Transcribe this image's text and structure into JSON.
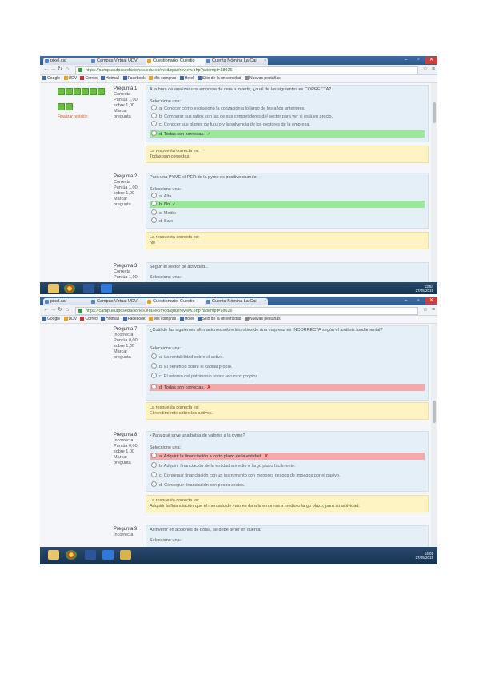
{
  "screens": [
    {
      "tabs": [
        "pixel.caf",
        "Campus Virtual UDV",
        "Cuestionario: Cuestio",
        "Cuenta Nómina La Cai"
      ],
      "url": "https://campusutpcsedaciones.edu.ec/mod/quiz/review.php?attempt=18026",
      "bookmarks": [
        "Google",
        "UDV",
        "Correo",
        "Hotmail",
        "Facebook",
        "Mis compras",
        "Hotel",
        "Sitio de la universidad",
        "Nuevas pestañas"
      ],
      "taskbar": {
        "time": "13:54",
        "date": "27/05/2015"
      },
      "side_block": {
        "finish_link": "Finalizar revisión"
      },
      "questions": [
        {
          "number": "Pregunta 1",
          "state": "Correcta",
          "mark": "Puntúa 1,00 sobre 1,00",
          "flag": "Marcar pregunta",
          "text": "A la hora de analizar una empresa de cara a invertir, ¿cuál de las siguientes es CORRECTA?",
          "select_label": "Seleccione una:",
          "options": [
            {
              "text": "a. Conocer cómo evolucionó la cotización a lo largo de los años anteriores.",
              "state": "none"
            },
            {
              "text": "b. Comparar sus ratios con las de sus competidores del sector para ver si está en precio.",
              "state": "none"
            },
            {
              "text": "c. Conocer sus planes de futuro y la solvencia de los gestores de la empresa.",
              "state": "none"
            },
            {
              "text": "d. Todas son correctas.",
              "state": "correct"
            }
          ],
          "feedback": [
            "La respuesta correcta es:",
            "Todas son correctas."
          ]
        },
        {
          "number": "Pregunta 2",
          "state": "Correcta",
          "mark": "Puntúa 1,00 sobre 1,00",
          "flag": "Marcar pregunta",
          "text": "Para una PYME el PER de la pyme es positivo cuando:",
          "select_label": "Seleccione una:",
          "options": [
            {
              "text": "a. Alta",
              "state": "none"
            },
            {
              "text": "b. No",
              "state": "correct"
            },
            {
              "text": "c. Medio",
              "state": "none"
            },
            {
              "text": "d. Bajo",
              "state": "none"
            }
          ],
          "feedback": [
            "La respuesta correcta es:",
            "No"
          ]
        },
        {
          "number": "Pregunta 3",
          "state": "Correcta",
          "mark": "Puntúa 1,00",
          "flag": "",
          "text": "Según el sector de actividad...",
          "select_label": "Seleccione una:",
          "options": [],
          "feedback": []
        }
      ]
    },
    {
      "tabs": [
        "pixel.caf",
        "Campus Virtual UDV",
        "Cuestionario: Cuestio",
        "Cuenta Nómina La Cai"
      ],
      "url": "https://campusutpcsedaciones.edu.ec/mod/quiz/review.php?attempt=18026",
      "bookmarks": [
        "Google",
        "UDV",
        "Correo",
        "Hotmail",
        "Facebook",
        "Mis compras",
        "Hotel",
        "Sitio de la universidad",
        "Nuevas pestañas"
      ],
      "taskbar": {
        "time": "14:01",
        "date": "27/05/2015"
      },
      "questions": [
        {
          "number": "Pregunta 7",
          "state": "Incorrecta",
          "mark": "Puntúa 0,00 sobre 1,00",
          "flag": "Marcar pregunta",
          "text": "¿Cuál de las siguientes afirmaciones sobre las ratios de una empresa es INCORRECTA según el análisis fundamental?",
          "select_label": "Seleccione una:",
          "options": [
            {
              "text": "a. La rentabilidad sobre el activo.",
              "state": "none"
            },
            {
              "text": "b. El beneficio sobre el capital propio.",
              "state": "none"
            },
            {
              "text": "c. El retorno del patrimonio sobre recursos propios.",
              "state": "none"
            },
            {
              "text": "d. Todas son correctas.",
              "state": "wrong"
            }
          ],
          "feedback": [
            "La respuesta correcta es:",
            "El rendimiento sobre los activos."
          ]
        },
        {
          "number": "Pregunta 8",
          "state": "Incorrecta",
          "mark": "Puntúa 0,00 sobre 1,00",
          "flag": "Marcar pregunta",
          "text": "¿Para qué sirve una bolsa de valores a la pyme?",
          "select_label": "Seleccione una:",
          "options": [
            {
              "text": "a. Adquirir la financiación a corto plazo de la entidad.",
              "state": "wrong"
            },
            {
              "text": "b. Adquirir financiación de la entidad a medio o largo plazo fácilmente.",
              "state": "none"
            },
            {
              "text": "c. Conseguir financiación con un instrumento con menores riesgos de impagos por el pasivo.",
              "state": "none"
            },
            {
              "text": "d. Conseguir financiación con pocos costes.",
              "state": "none"
            }
          ],
          "feedback": [
            "La respuesta correcta es:",
            "Adquirir la financiación que el mercado de valores da a la empresa a medio o largo plazo, para su actividad."
          ]
        },
        {
          "number": "Pregunta 9",
          "state": "Incorrecta",
          "mark": "",
          "flag": "",
          "text": "Al invertir en acciones de bolsa, se debe tener en cuenta:",
          "select_label": "Seleccione una:",
          "options": [],
          "feedback": []
        }
      ]
    }
  ]
}
